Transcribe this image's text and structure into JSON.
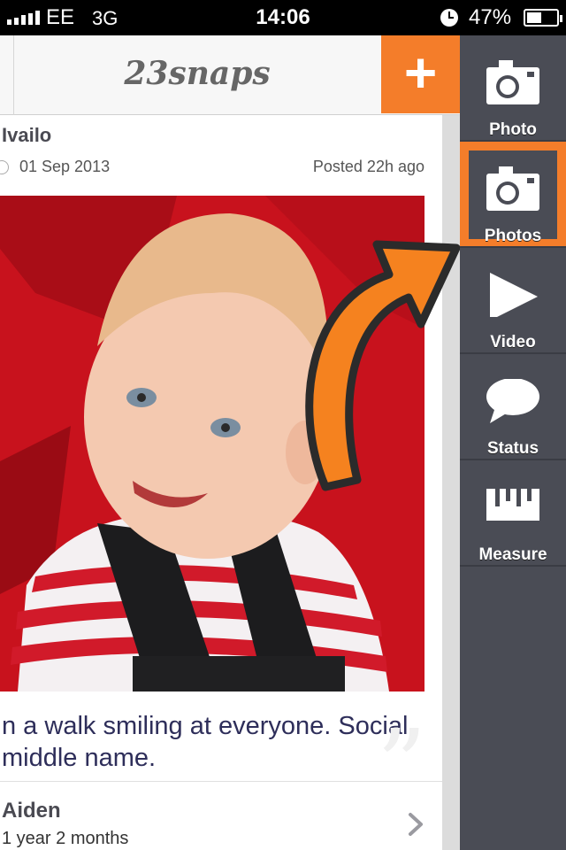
{
  "status_bar": {
    "carrier": "EE",
    "network": "3G",
    "time": "14:06",
    "battery": "47%"
  },
  "header": {
    "logo": "23snaps",
    "add_label": "+"
  },
  "post": {
    "user": "Ivailo",
    "date": "01 Sep 2013",
    "posted": "Posted 22h ago",
    "caption_lines": [
      "n a walk smiling at everyone. Social",
      " middle name."
    ]
  },
  "child": {
    "name": "Aiden",
    "age": "1 year 2 months"
  },
  "side_menu": {
    "items": [
      {
        "label": "Photo",
        "icon": "camera-icon"
      },
      {
        "label": "Photos",
        "icon": "camera-icon",
        "active": true
      },
      {
        "label": "Video",
        "icon": "play-icon"
      },
      {
        "label": "Status",
        "icon": "speech-bubble-icon"
      },
      {
        "label": "Measure",
        "icon": "ruler-icon"
      }
    ]
  },
  "colors": {
    "accent": "#f47d2a",
    "menu_bg": "#4a4c55",
    "caption_text": "#2e2e5a"
  }
}
